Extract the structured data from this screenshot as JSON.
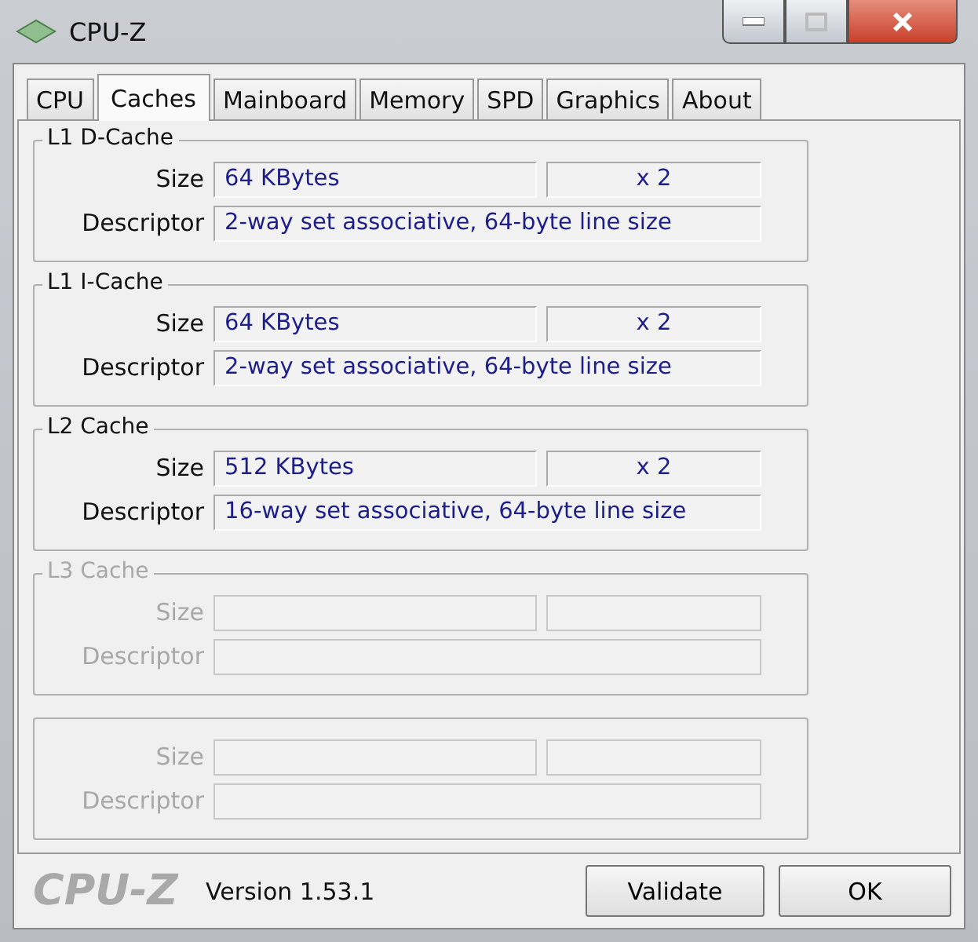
{
  "window": {
    "title": "CPU-Z"
  },
  "tabs": [
    {
      "label": "CPU",
      "selected": false
    },
    {
      "label": "Caches",
      "selected": true
    },
    {
      "label": "Mainboard",
      "selected": false
    },
    {
      "label": "Memory",
      "selected": false
    },
    {
      "label": "SPD",
      "selected": false
    },
    {
      "label": "Graphics",
      "selected": false
    },
    {
      "label": "About",
      "selected": false
    }
  ],
  "groups": [
    {
      "title": "L1 D-Cache",
      "disabled": false,
      "size_label": "Size",
      "descriptor_label": "Descriptor",
      "size": "64 KBytes",
      "count": "x 2",
      "descriptor": "2-way set associative, 64-byte line size"
    },
    {
      "title": "L1 I-Cache",
      "disabled": false,
      "size_label": "Size",
      "descriptor_label": "Descriptor",
      "size": "64 KBytes",
      "count": "x 2",
      "descriptor": "2-way set associative, 64-byte line size"
    },
    {
      "title": "L2 Cache",
      "disabled": false,
      "size_label": "Size",
      "descriptor_label": "Descriptor",
      "size": "512 KBytes",
      "count": "x 2",
      "descriptor": "16-way set associative, 64-byte line size"
    },
    {
      "title": "L3 Cache",
      "disabled": true,
      "size_label": "Size",
      "descriptor_label": "Descriptor"
    },
    {
      "disabled": true,
      "size_label": "Size",
      "descriptor_label": "Descriptor"
    }
  ],
  "footer": {
    "logo": "CPU-Z",
    "version": "Version 1.53.1",
    "buttons": [
      "Validate",
      "OK"
    ]
  }
}
